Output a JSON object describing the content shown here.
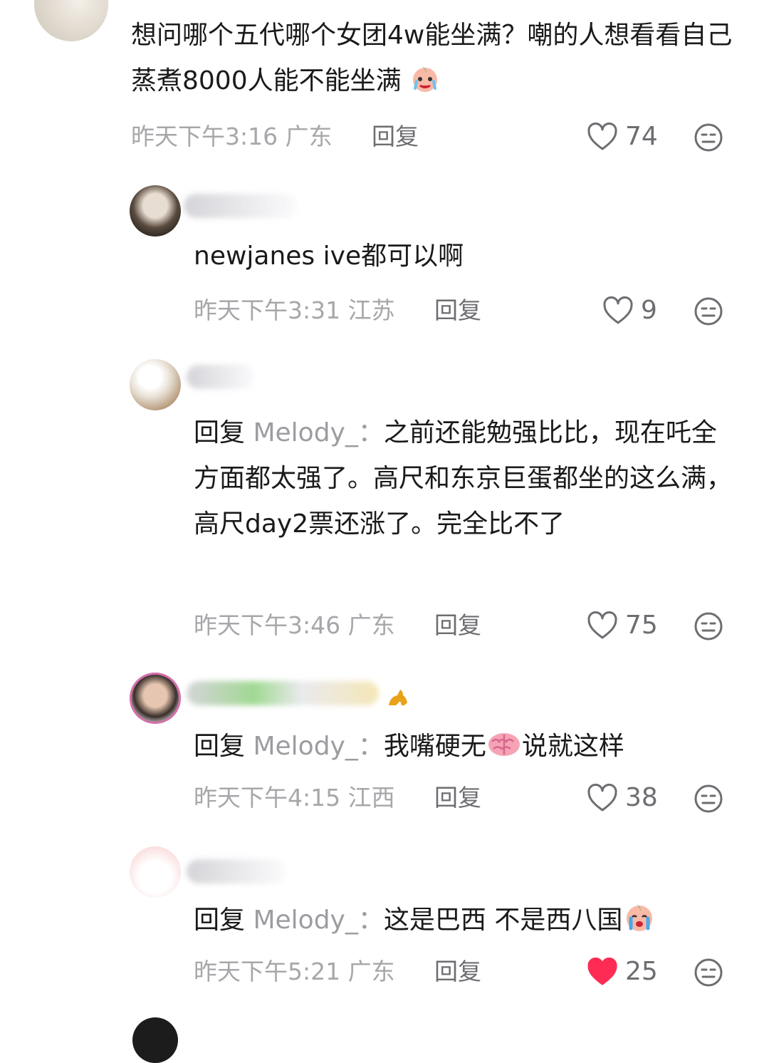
{
  "comments": [
    {
      "text": "想问哪个五代哪个女团4w能坐满？嘲的人想看看自己蒸煮8000人能不能坐满",
      "time": "昨天下午3:16",
      "location": "广东",
      "reply_label": "回复",
      "likes": "74",
      "liked": false
    }
  ],
  "replies": [
    {
      "text": "newjanes ive都可以啊",
      "time": "昨天下午3:31",
      "location": "江苏",
      "reply_label": "回复",
      "likes": "9",
      "liked": false
    },
    {
      "prefix": "回复",
      "mention": "Melody_：",
      "text": "之前还能勉强比比，现在吒全方面都太强了。高尺和东京巨蛋都坐的这么满，高尺day2票还涨了。完全比不了",
      "time": "昨天下午3:46",
      "location": "广东",
      "reply_label": "回复",
      "likes": "75",
      "liked": false
    },
    {
      "prefix": "回复",
      "mention": "Melody_：",
      "text_before": "我嘴硬无",
      "text_after": "说就这样",
      "emoji": "brain-emoji",
      "time": "昨天下午4:15",
      "location": "江西",
      "reply_label": "回复",
      "likes": "38",
      "liked": false
    },
    {
      "prefix": "回复",
      "mention": "Melody_：",
      "text": "这是巴西  不是西八国",
      "emoji": "crying-peach-emoji",
      "time": "昨天下午5:21",
      "location": "广东",
      "reply_label": "回复",
      "likes": "25",
      "liked": true
    }
  ],
  "colors": {
    "liked": "#fe2c55",
    "meta": "#a7a7ab",
    "action": "#6d6d72"
  },
  "icons": {
    "like": "heart-icon",
    "dislike": "meh-face-icon"
  }
}
